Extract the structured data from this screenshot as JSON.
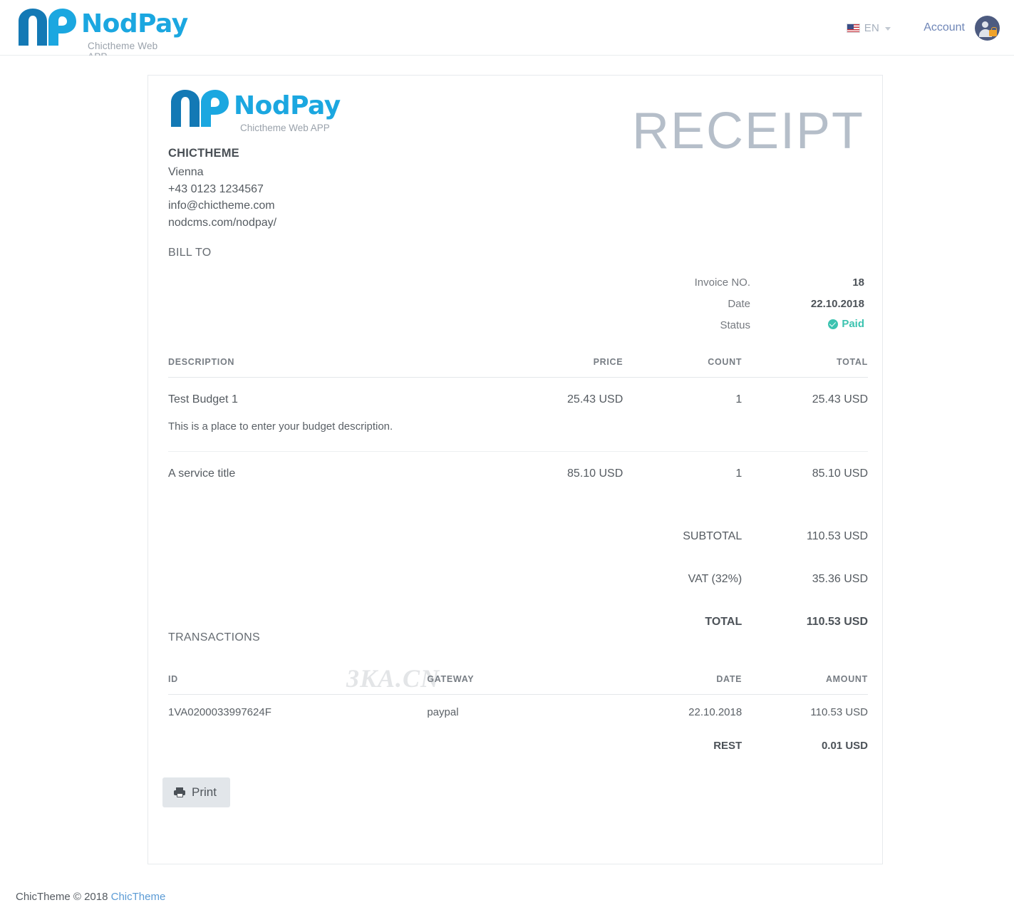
{
  "topbar": {
    "brand": {
      "word": "NodPay",
      "tagline": "Chictheme Web APP"
    },
    "language": {
      "code": "EN",
      "flag_icon": "us-flag-icon",
      "chevron_icon": "chevron-down-icon"
    },
    "account_label": "Account",
    "avatar_icon": "user-lock-avatar-icon"
  },
  "receipt": {
    "title": "RECEIPT",
    "logo": {
      "word": "NodPay",
      "tagline": "Chictheme Web APP"
    },
    "business": {
      "name": "CHICTHEME",
      "lines": [
        "Vienna",
        "+43 0123 1234567",
        "info@chictheme.com",
        "nodcms.com/nodpay/"
      ]
    },
    "bill_to_label": "BILL TO",
    "meta": [
      {
        "label": "Invoice NO.",
        "value": "18"
      },
      {
        "label": "Date",
        "value": "22.10.2018"
      },
      {
        "label": "Status",
        "value": "Paid",
        "status_icon": "check-circle-icon",
        "status_color": "#3cc3b0"
      }
    ],
    "watermark": "3KA.CN"
  },
  "items_table": {
    "headers": [
      "DESCRIPTION",
      "PRICE",
      "COUNT",
      "TOTAL"
    ],
    "rows": [
      {
        "description": "Test Budget 1",
        "price": "25.43 USD",
        "count": "1",
        "total": "25.43 USD",
        "detail": "This is a place to enter your budget description."
      },
      {
        "description": "A service title",
        "price": "85.10 USD",
        "count": "1",
        "total": "85.10 USD",
        "detail": ""
      }
    ],
    "summary": [
      {
        "label": "SUBTOTAL",
        "value": "110.53 USD"
      },
      {
        "label": "VAT (32%)",
        "value": "35.36 USD"
      },
      {
        "label": "TOTAL",
        "value": "110.53 USD"
      }
    ]
  },
  "transactions": {
    "title": "TRANSACTIONS",
    "headers": [
      "ID",
      "GATEWAY",
      "DATE",
      "AMOUNT"
    ],
    "rows": [
      {
        "id": "1VA0200033997624F",
        "gateway": "paypal",
        "date": "22.10.2018",
        "amount": "110.53 USD"
      }
    ],
    "rest": {
      "label": "REST",
      "value": "0.01 USD"
    }
  },
  "print_button": {
    "label": "Print",
    "icon": "printer-icon"
  },
  "footer": {
    "text": "ChicTheme © 2018",
    "link": "ChicTheme"
  }
}
